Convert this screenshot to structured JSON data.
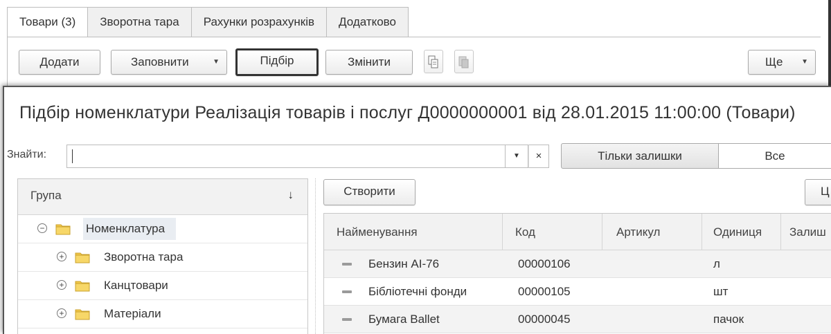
{
  "document": {
    "tabs": [
      "Товари (3)",
      "Зворотна тара",
      "Рахунки розрахунків",
      "Додатково"
    ],
    "toolbar": {
      "add": "Додати",
      "fill": "Заповнити",
      "pick": "Підбір",
      "change": "Змінити",
      "more": "Ще"
    }
  },
  "dialog": {
    "title": "Підбір номенклатури Реалізація товарів і послуг Д0000000001 від 28.01.2015 11:00:00 (Товари)",
    "find_label": "Знайти:",
    "find_value": "",
    "filter_only_remains": "Тільки залишки",
    "filter_all": "Все",
    "create": "Створити",
    "right_button_cut": "Ц",
    "groups": {
      "header": "Група",
      "sort_icon": "↓",
      "items": [
        {
          "label": "Номенклатура",
          "expanded": true,
          "level": 0
        },
        {
          "label": "Зворотна тара",
          "expanded": false,
          "level": 1
        },
        {
          "label": "Канцтовари",
          "expanded": false,
          "level": 1
        },
        {
          "label": "Матеріали",
          "expanded": false,
          "level": 1
        }
      ]
    },
    "grid": {
      "columns": [
        "Найменування",
        "Код",
        "Артикул",
        "Одиниця",
        "Залиш"
      ],
      "rows": [
        {
          "name": "Бензин АІ-76",
          "code": "00000106",
          "article": "",
          "unit": "л"
        },
        {
          "name": "Бібліотечні фонди",
          "code": "00000105",
          "article": "",
          "unit": "шт"
        },
        {
          "name": "Бумага Ballet",
          "code": "00000045",
          "article": "",
          "unit": "пачок"
        }
      ]
    }
  },
  "colors": {
    "tree_selected_bg": "#e9edf2",
    "folder_yellow": "#f3c94a",
    "grid_alt_row": "#f3f3f3"
  }
}
